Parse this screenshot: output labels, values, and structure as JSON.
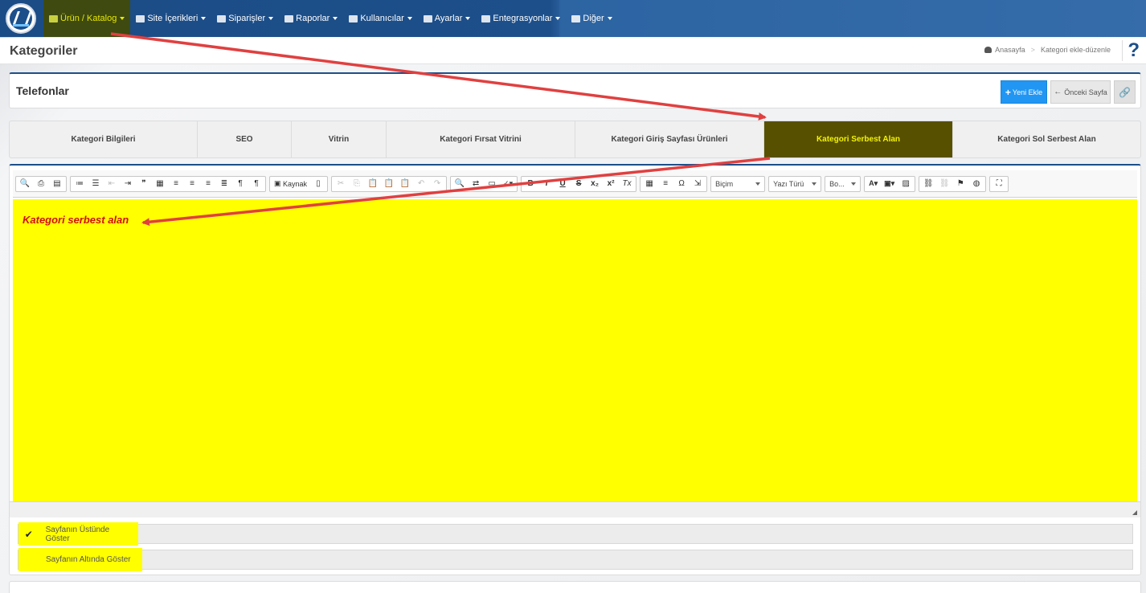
{
  "nav": {
    "items": [
      {
        "label": "Ürün / Katalog",
        "icon": "products-icon",
        "active": true
      },
      {
        "label": "Site İçerikleri",
        "icon": "pages-icon"
      },
      {
        "label": "Siparişler",
        "icon": "truck-icon"
      },
      {
        "label": "Raporlar",
        "icon": "report-icon"
      },
      {
        "label": "Kullanıcılar",
        "icon": "users-icon"
      },
      {
        "label": "Ayarlar",
        "icon": "gears-icon"
      },
      {
        "label": "Entegrasyonlar",
        "icon": "sitemap-icon"
      },
      {
        "label": "Diğer",
        "icon": "grid-icon"
      }
    ]
  },
  "page": {
    "title": "Kategoriler",
    "breadcrumb": {
      "home": "Anasayfa",
      "current": "Kategori ekle-düzenle"
    }
  },
  "header": {
    "title": "Telefonlar",
    "new_label": "Yeni Ekle",
    "back_label": "Önceki Sayfa"
  },
  "tabs": [
    {
      "label": "Kategori Bilgileri"
    },
    {
      "label": "SEO"
    },
    {
      "label": "Vitrin"
    },
    {
      "label": "Kategori Fırsat Vitrini"
    },
    {
      "label": "Kategori Giriş Sayfası Ürünleri"
    },
    {
      "label": "Kategori Serbest Alan",
      "active": true
    },
    {
      "label": "Kategori Sol Serbest Alan"
    }
  ],
  "editor": {
    "source_label": "Kaynak",
    "format_label": "Biçim",
    "font_label": "Yazı Türü",
    "size_label": "Bo...",
    "content": "Kategori serbest alan"
  },
  "options": {
    "top": {
      "label": "Sayfanın Üstünde Göster",
      "checked": true
    },
    "bottom": {
      "label": "Sayfanın Altında Göster",
      "checked": false
    }
  },
  "colors": {
    "nav_bg": "#1d4f8a",
    "active_tab": "#575000",
    "active_tab_text": "#f3f300",
    "highlight": "#ffff00",
    "annotation": "#e04040",
    "primary_button": "#2196f3"
  }
}
